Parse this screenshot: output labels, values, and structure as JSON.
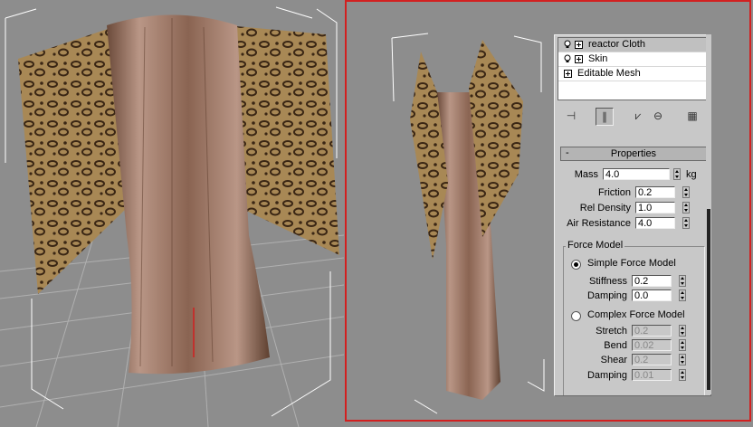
{
  "modifier_stack": {
    "items": [
      {
        "label": "reactor Cloth",
        "has_bulb": true,
        "expandable": true,
        "selected": true
      },
      {
        "label": "Skin",
        "has_bulb": true,
        "expandable": true,
        "selected": false
      },
      {
        "label": "Editable Mesh",
        "has_bulb": false,
        "expandable": true,
        "selected": false
      }
    ],
    "tools": [
      {
        "name": "pin-stack-icon",
        "glyph": "⊣"
      },
      {
        "name": "show-end-result-icon",
        "glyph": "∥"
      },
      {
        "name": "make-unique-icon",
        "glyph": "⩗"
      },
      {
        "name": "remove-modifier-icon",
        "glyph": "⊖"
      },
      {
        "name": "configure-modifier-sets-icon",
        "glyph": "▦"
      }
    ]
  },
  "properties": {
    "title": "Properties",
    "collapse_glyph": "-",
    "mass": {
      "label": "Mass",
      "value": "4.0",
      "unit": "kg"
    },
    "friction": {
      "label": "Friction",
      "value": "0.2"
    },
    "rel_density": {
      "label": "Rel Density",
      "value": "1.0"
    },
    "air_resistance": {
      "label": "Air Resistance",
      "value": "4.0"
    },
    "force_model": {
      "group_label": "Force Model",
      "simple": {
        "label": "Simple Force Model",
        "selected": true,
        "stiffness": {
          "label": "Stiffness",
          "value": "0.2"
        },
        "damping": {
          "label": "Damping",
          "value": "0.0"
        }
      },
      "complex": {
        "label": "Complex Force Model",
        "selected": false,
        "stretch": {
          "label": "Stretch",
          "value": "0.2"
        },
        "bend": {
          "label": "Bend",
          "value": "0.02"
        },
        "shear": {
          "label": "Shear",
          "value": "0.2"
        },
        "damping": {
          "label": "Damping",
          "value": "0.01"
        }
      }
    }
  },
  "colors": {
    "viewport_bg": "#8d8d8d",
    "active_viewport_border": "#d22020",
    "panel_bg": "#c8c8c8",
    "robe_inner": "#b08f7a",
    "robe_pattern": "#8d6a3c"
  }
}
